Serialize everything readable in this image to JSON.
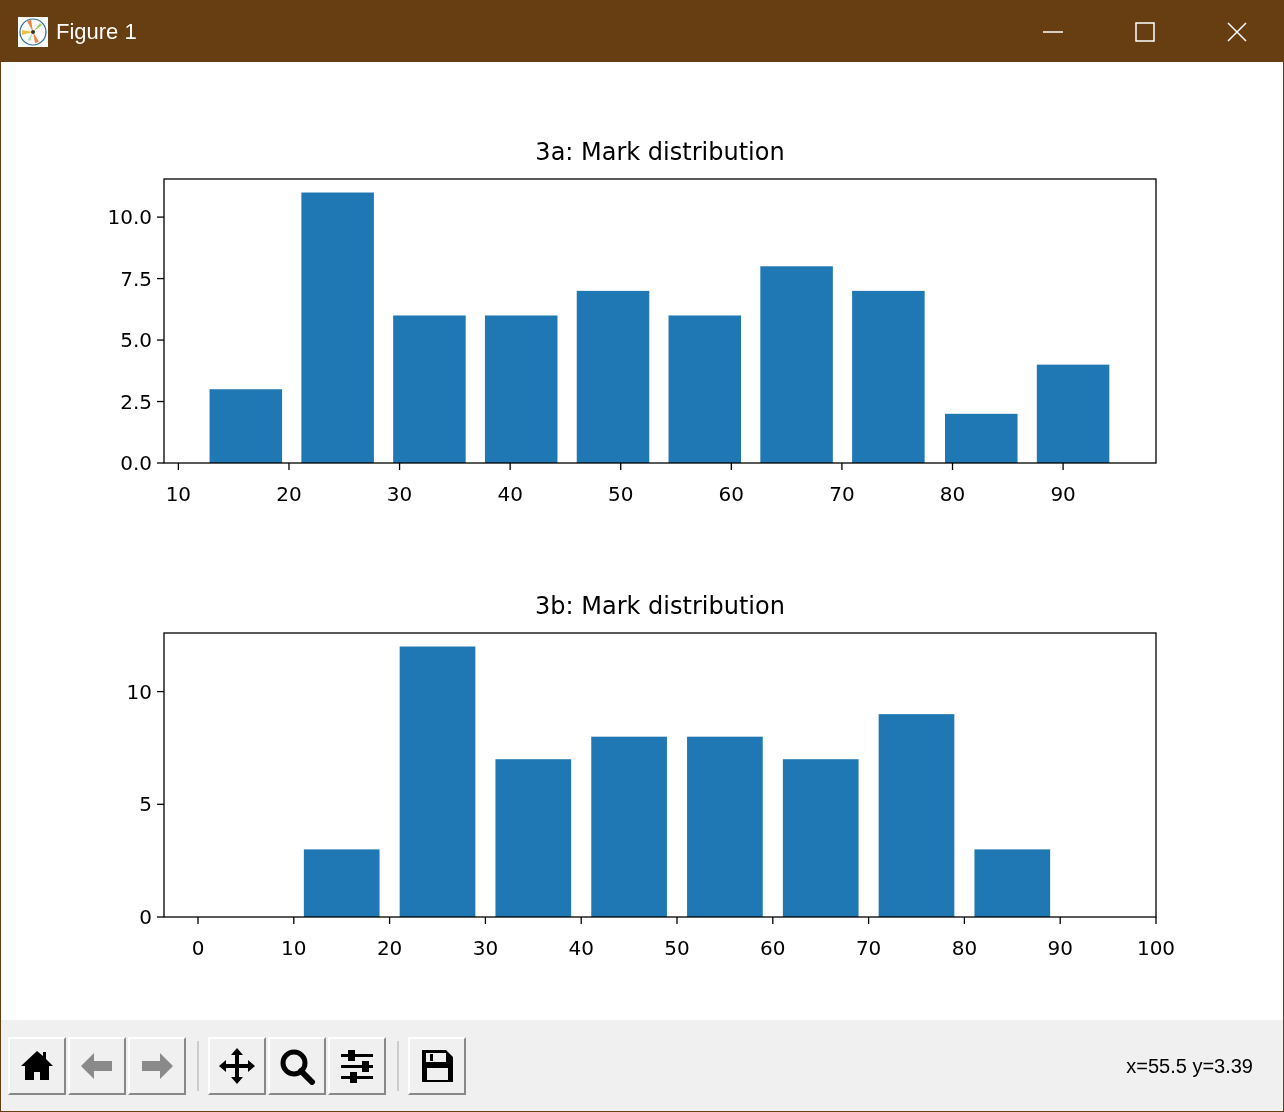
{
  "window": {
    "title": "Figure 1"
  },
  "figure": {
    "plots": [
      {
        "chart_data": {
          "type": "bar",
          "title": "3a: Mark distribution",
          "x": [
            16.1,
            24.4,
            32.7,
            41.0,
            49.3,
            57.6,
            65.9,
            74.2,
            82.6,
            90.9
          ],
          "series": [
            {
              "color": "#1f77b4",
              "values": [
                3,
                11,
                6,
                6,
                7,
                6,
                8,
                7,
                2,
                4
              ]
            }
          ],
          "xlim": [
            8.7,
            98.4
          ],
          "ylim": [
            0,
            11.55
          ],
          "xticks": [
            10,
            20,
            30,
            40,
            50,
            60,
            70,
            80,
            90
          ],
          "yticks": [
            {
              "value": 0,
              "label": "0.0"
            },
            {
              "value": 2.5,
              "label": "2.5"
            },
            {
              "value": 5,
              "label": "5.0"
            },
            {
              "value": 7.5,
              "label": "7.5"
            },
            {
              "value": 10,
              "label": "10.0"
            }
          ]
        }
      },
      {
        "chart_data": {
          "type": "bar",
          "title": "3b: Mark distribution",
          "x": [
            15,
            25,
            35,
            45,
            55,
            65,
            75,
            85
          ],
          "series": [
            {
              "color": "#1f77b4",
              "values": [
                3,
                12,
                7,
                8,
                8,
                7,
                9,
                3
              ]
            }
          ],
          "xlim": [
            -3.55,
            100
          ],
          "ylim": [
            0,
            12.6
          ],
          "xticks": [
            0,
            10,
            20,
            30,
            40,
            50,
            60,
            70,
            80,
            90,
            100
          ],
          "yticks": [
            0,
            5,
            10
          ]
        }
      }
    ]
  },
  "toolbar": {
    "groups": [
      [
        {
          "kind": "home",
          "disabled": false
        },
        {
          "kind": "back",
          "disabled": true
        },
        {
          "kind": "forward",
          "disabled": true
        }
      ],
      [
        {
          "kind": "pan",
          "disabled": false
        },
        {
          "kind": "zoom",
          "disabled": false
        },
        {
          "kind": "configure",
          "disabled": false
        }
      ],
      [
        {
          "kind": "save",
          "disabled": false
        }
      ]
    ],
    "status": "x=55.5 y=3.39"
  }
}
